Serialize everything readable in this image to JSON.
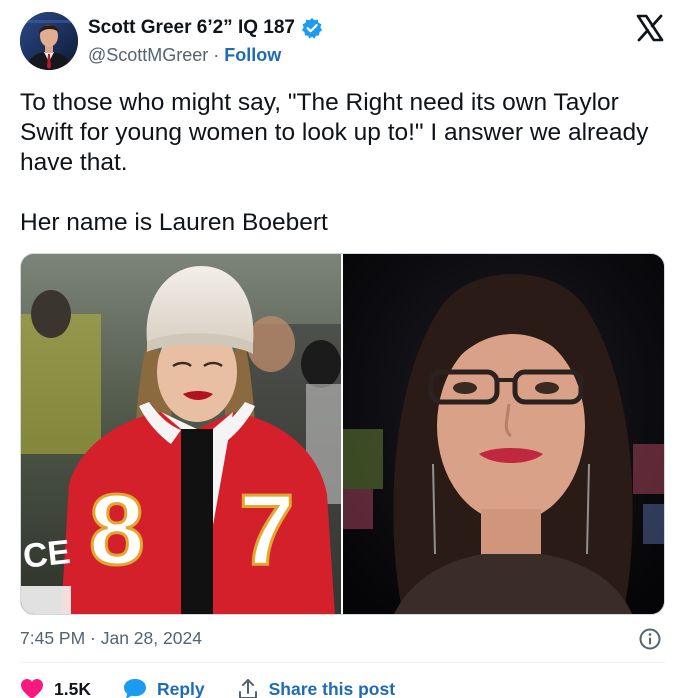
{
  "author": {
    "display_name": "Scott Greer 6’2” IQ 187",
    "handle": "@ScottMGreer",
    "separator": "·",
    "follow_label": "Follow"
  },
  "tweet": {
    "paragraphs": [
      "To those who might say, \"The Right need its own Taylor Swift for young women to look up to!\" I answer we already have that.",
      "Her name is Lauren Boebert"
    ]
  },
  "media": {
    "left_jersey_number": "87",
    "left_sleeve_text": "CE"
  },
  "meta": {
    "timestamp": "7:45 PM · Jan 28, 2024"
  },
  "actions": {
    "like_count": "1.5K",
    "reply_label": "Reply",
    "share_label": "Share this post"
  },
  "colors": {
    "accent": "#1d6bb5",
    "verified": "#1d9bf0",
    "like": "#f91880",
    "text_primary": "#0f1419",
    "text_secondary": "#536471",
    "jersey_red": "#d3202a"
  }
}
